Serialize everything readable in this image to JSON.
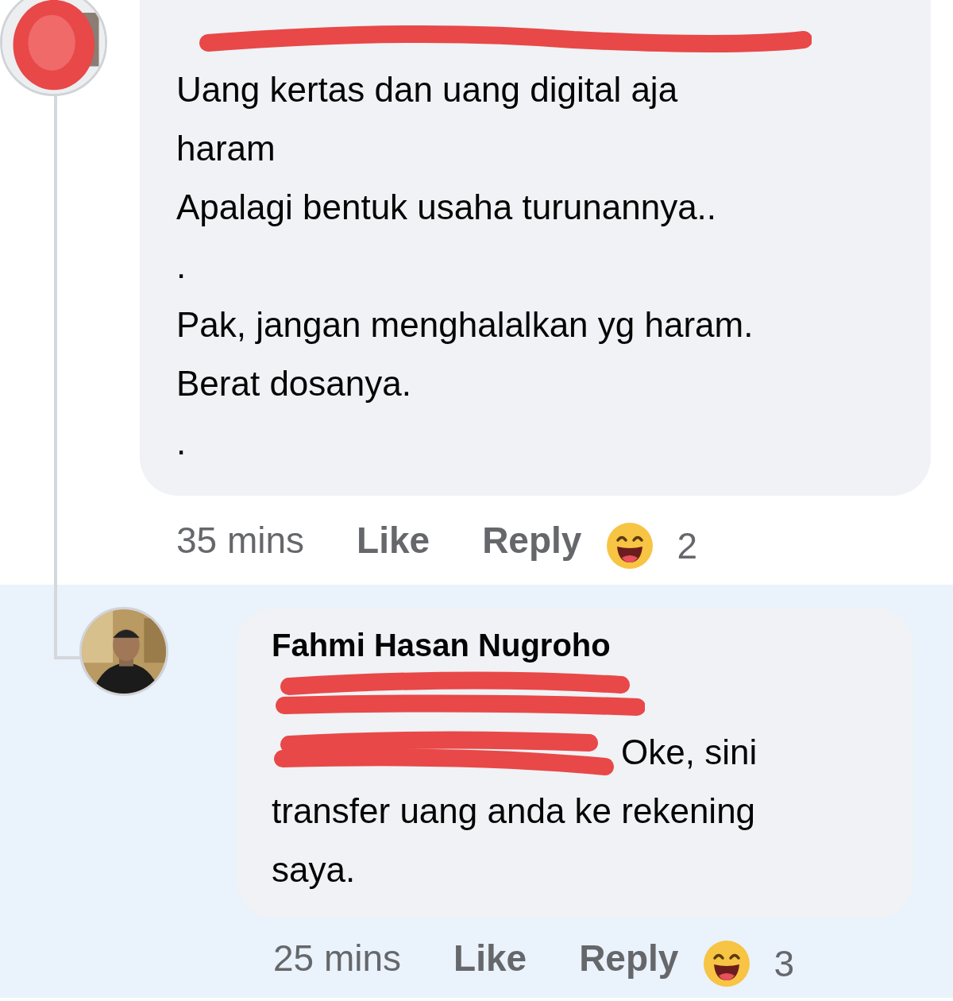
{
  "comments": [
    {
      "avatar": {
        "kind": "picture",
        "redacted": true
      },
      "author": {
        "redacted": true
      },
      "lines": [
        "Uang kertas dan uang digital aja",
        "haram",
        "Apalagi bentuk usaha turunannya..",
        ".",
        "Pak, jangan menghalalkan yg haram.",
        "Berat dosanya.",
        "."
      ],
      "time": "35 mins",
      "actions": [
        "Like",
        "Reply"
      ],
      "reaction_count": "2",
      "highlighted": false
    },
    {
      "avatar": {
        "kind": "picture",
        "redacted": false
      },
      "author": {
        "name": "Fahmi Hasan Nugroho",
        "redacted": false
      },
      "mention": {
        "redacted": true
      },
      "lines": [
        "Oke, sini",
        "transfer uang anda ke rekening",
        "saya."
      ],
      "time": "25 mins",
      "actions": [
        "Like",
        "Reply"
      ],
      "reaction_count": "3",
      "highlighted": true
    }
  ]
}
